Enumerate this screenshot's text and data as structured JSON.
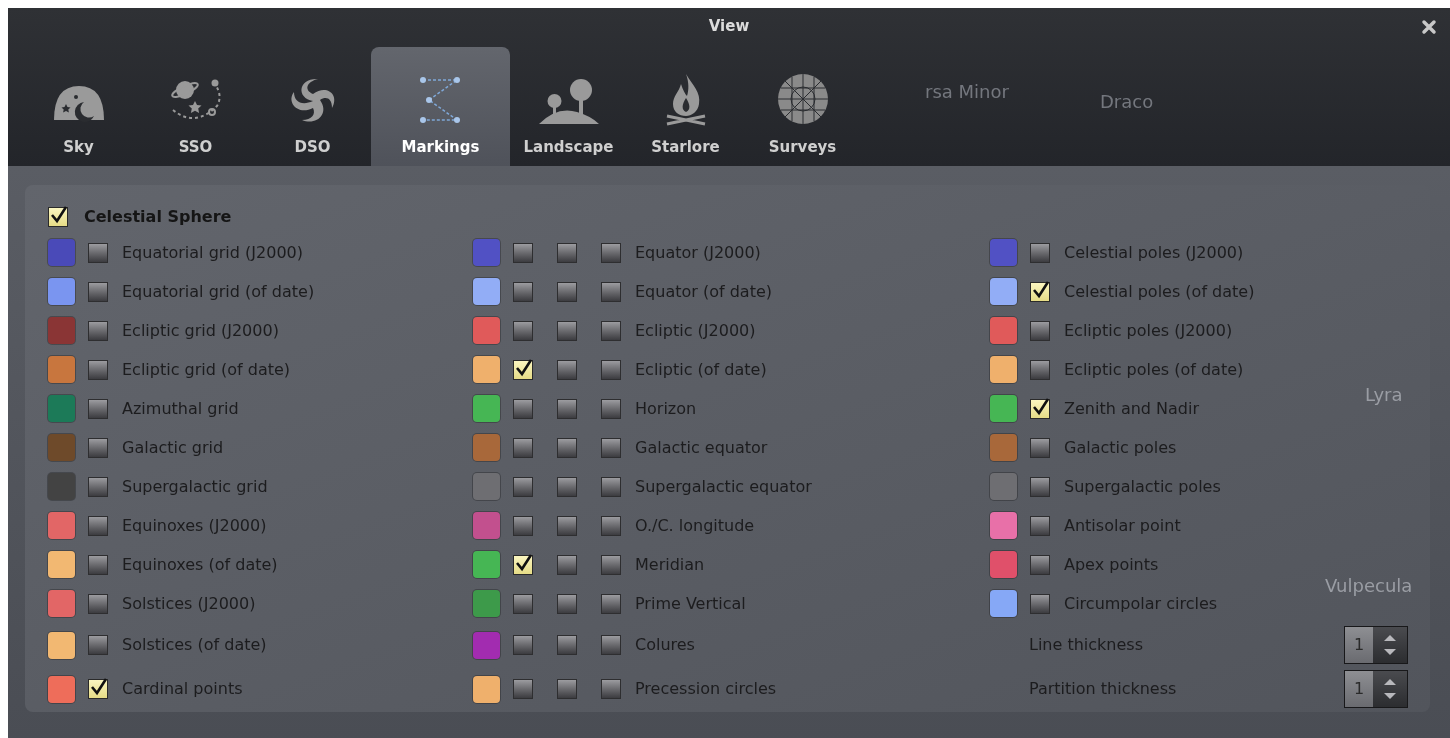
{
  "window": {
    "title": "View"
  },
  "tabs": [
    {
      "label": "Sky",
      "selected": false
    },
    {
      "label": "SSO",
      "selected": false
    },
    {
      "label": "DSO",
      "selected": false
    },
    {
      "label": "Markings",
      "selected": true
    },
    {
      "label": "Landscape",
      "selected": false
    },
    {
      "label": "Starlore",
      "selected": false
    },
    {
      "label": "Surveys",
      "selected": false
    }
  ],
  "sky_labels": [
    {
      "text": "rsa Minor"
    },
    {
      "text": "Draco"
    },
    {
      "text": "Lyra"
    },
    {
      "text": "Vulpecula"
    }
  ],
  "section": {
    "label": "Celestial Sphere",
    "checked": true
  },
  "columns": [
    {
      "items": [
        {
          "kind": "toggle",
          "label": "Equatorial grid (J2000)",
          "color": "#4a4ab8",
          "checks": [
            false
          ]
        },
        {
          "kind": "toggle",
          "label": "Equatorial grid (of date)",
          "color": "#7a95f0",
          "checks": [
            false
          ]
        },
        {
          "kind": "toggle",
          "label": "Ecliptic grid (J2000)",
          "color": "#8a3535",
          "checks": [
            false
          ]
        },
        {
          "kind": "toggle",
          "label": "Ecliptic grid (of date)",
          "color": "#c8763e",
          "checks": [
            false
          ]
        },
        {
          "kind": "toggle",
          "label": "Azimuthal grid",
          "color": "#1c7a58",
          "checks": [
            false
          ]
        },
        {
          "kind": "toggle",
          "label": "Galactic grid",
          "color": "#6e4a2a",
          "checks": [
            false
          ]
        },
        {
          "kind": "toggle",
          "label": "Supergalactic grid",
          "color": "#434343",
          "checks": [
            false
          ]
        },
        {
          "kind": "toggle",
          "label": "Equinoxes (J2000)",
          "color": "#e26666",
          "checks": [
            false
          ]
        },
        {
          "kind": "toggle",
          "label": "Equinoxes (of date)",
          "color": "#f2b872",
          "checks": [
            false
          ]
        },
        {
          "kind": "toggle",
          "label": "Solstices (J2000)",
          "color": "#e26666",
          "checks": [
            false
          ]
        },
        {
          "kind": "toggle",
          "label": "Solstices (of date)",
          "color": "#f2b872",
          "checks": [
            false
          ]
        },
        {
          "kind": "toggle",
          "label": "Cardinal points",
          "color": "#ee6d5a",
          "checks": [
            true
          ]
        }
      ]
    },
    {
      "items": [
        {
          "kind": "toggle",
          "label": "Equator (J2000)",
          "color": "#5151c4",
          "checks": [
            false,
            false,
            false
          ]
        },
        {
          "kind": "toggle",
          "label": "Equator (of date)",
          "color": "#92adf6",
          "checks": [
            false,
            false,
            false
          ]
        },
        {
          "kind": "toggle",
          "label": "Ecliptic (J2000)",
          "color": "#e05a5a",
          "checks": [
            false,
            false,
            false
          ]
        },
        {
          "kind": "toggle",
          "label": "Ecliptic (of date)",
          "color": "#efb06c",
          "checks": [
            true,
            false,
            false
          ]
        },
        {
          "kind": "toggle",
          "label": "Horizon",
          "color": "#46b654",
          "checks": [
            false,
            false,
            false
          ]
        },
        {
          "kind": "toggle",
          "label": "Galactic equator",
          "color": "#a8683a",
          "checks": [
            false,
            false,
            false
          ]
        },
        {
          "kind": "toggle",
          "label": "Supergalactic equator",
          "color": "#6e6e72",
          "checks": [
            false,
            false,
            false
          ]
        },
        {
          "kind": "toggle",
          "label": "O./C. longitude",
          "color": "#c2508e",
          "checks": [
            false,
            false,
            false
          ]
        },
        {
          "kind": "toggle",
          "label": "Meridian",
          "color": "#46b654",
          "checks": [
            true,
            false,
            false
          ]
        },
        {
          "kind": "toggle",
          "label": "Prime Vertical",
          "color": "#3d9a4a",
          "checks": [
            false,
            false,
            false
          ]
        },
        {
          "kind": "toggle",
          "label": "Colures",
          "color": "#a22cb0",
          "checks": [
            false,
            false,
            false
          ]
        },
        {
          "kind": "toggle",
          "label": "Precession circles",
          "color": "#efb06c",
          "checks": [
            false,
            false,
            false
          ]
        }
      ]
    },
    {
      "items": [
        {
          "kind": "toggle",
          "label": "Celestial poles (J2000)",
          "color": "#5151c4",
          "checks": [
            false
          ]
        },
        {
          "kind": "toggle",
          "label": "Celestial poles (of date)",
          "color": "#92adf6",
          "checks": [
            true
          ]
        },
        {
          "kind": "toggle",
          "label": "Ecliptic poles (J2000)",
          "color": "#e05a5a",
          "checks": [
            false
          ]
        },
        {
          "kind": "toggle",
          "label": "Ecliptic poles (of date)",
          "color": "#efb06c",
          "checks": [
            false
          ]
        },
        {
          "kind": "toggle",
          "label": "Zenith and Nadir",
          "color": "#46b654",
          "checks": [
            true
          ]
        },
        {
          "kind": "toggle",
          "label": "Galactic poles",
          "color": "#a8683a",
          "checks": [
            false
          ]
        },
        {
          "kind": "toggle",
          "label": "Supergalactic poles",
          "color": "#6e6e72",
          "checks": [
            false
          ]
        },
        {
          "kind": "toggle",
          "label": "Antisolar point",
          "color": "#e870a8",
          "checks": [
            false
          ]
        },
        {
          "kind": "toggle",
          "label": "Apex points",
          "color": "#e0506a",
          "checks": [
            false
          ]
        },
        {
          "kind": "toggle",
          "label": "Circumpolar circles",
          "color": "#86a8f6",
          "checks": [
            false
          ]
        },
        {
          "kind": "spinner",
          "label": "Line thickness",
          "value": "1"
        },
        {
          "kind": "spinner",
          "label": "Partition thickness",
          "value": "1"
        }
      ]
    }
  ]
}
